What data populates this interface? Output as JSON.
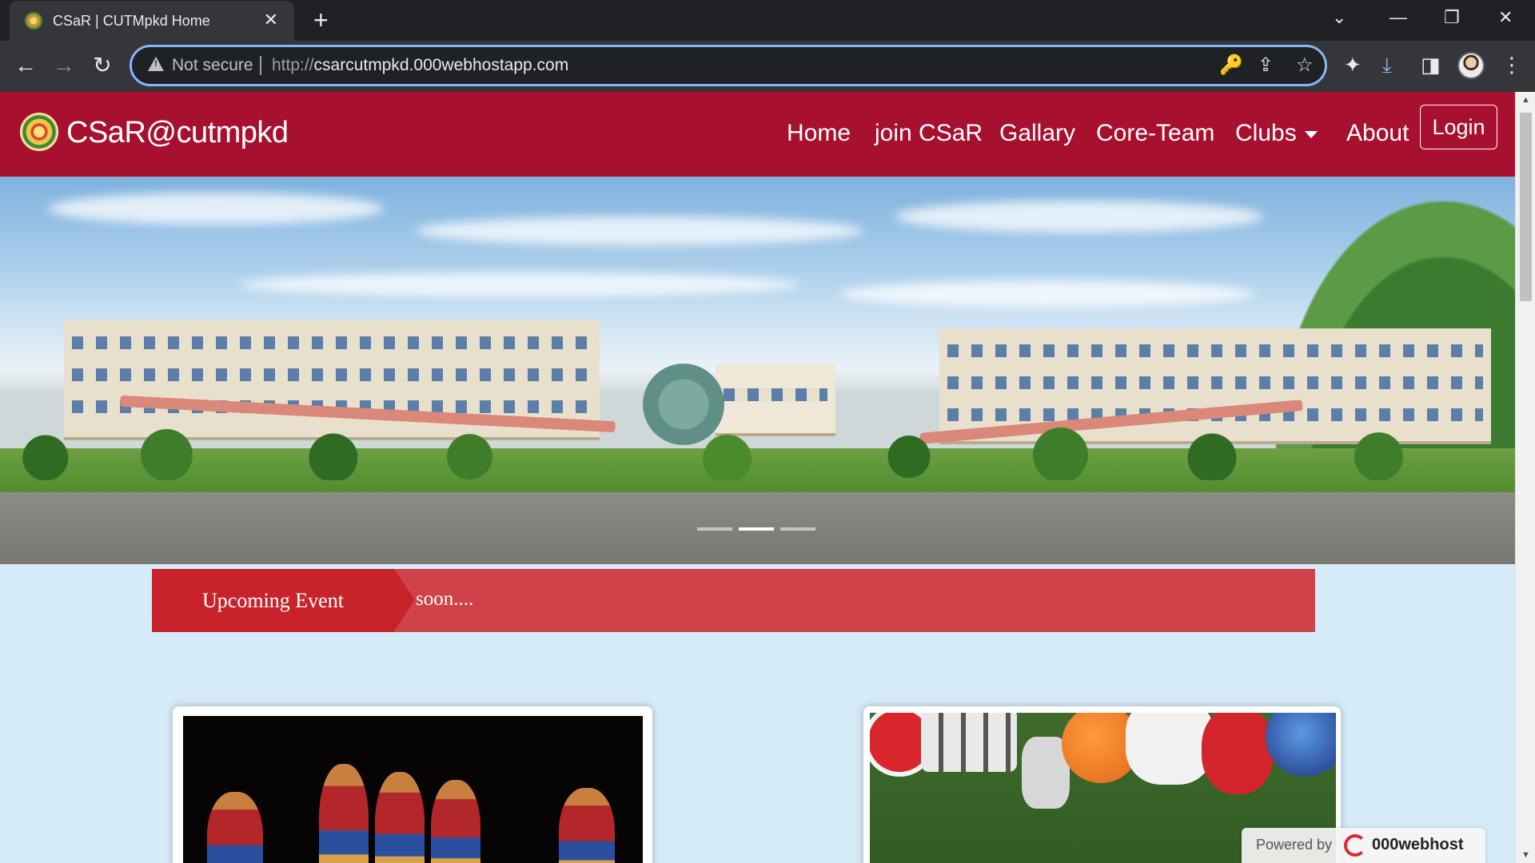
{
  "browser": {
    "tab_title": "CSaR | CUTMpkd Home",
    "tab_close": "✕",
    "new_tab": "+",
    "security_label": "Not secure",
    "url_scheme": "http://",
    "url_host": "csarcutmpkd.000webhostapp.com",
    "window_controls": {
      "tab_search": "⌄",
      "minimize": "—",
      "restore": "❐",
      "close": "✕"
    },
    "nav": {
      "back": "←",
      "forward": "→",
      "reload": "↻"
    },
    "icons": {
      "key": "🔑",
      "share": "⇪",
      "star": "☆",
      "extensions": "✦",
      "download": "⤓",
      "sidepanel": "◨",
      "menu": "⋮"
    }
  },
  "site": {
    "brand": "CSaR@cutmpkd",
    "nav_links": [
      "Home",
      "join CSaR",
      "Gallary",
      "Core-Team",
      "Clubs",
      "About"
    ],
    "login_label": "Login",
    "carousel": {
      "slide_count": 3,
      "active_index": 1
    },
    "ticker": {
      "label": "Upcoming Event",
      "text": "soon...."
    },
    "footer_badge": {
      "powered_by": "Powered by",
      "brand": "000webhost"
    },
    "colors": {
      "navbar": "#a8102f",
      "ticker_label": "#c8232a",
      "ticker_bar": "#d04249",
      "page_bg": "#d6ebf8"
    }
  }
}
